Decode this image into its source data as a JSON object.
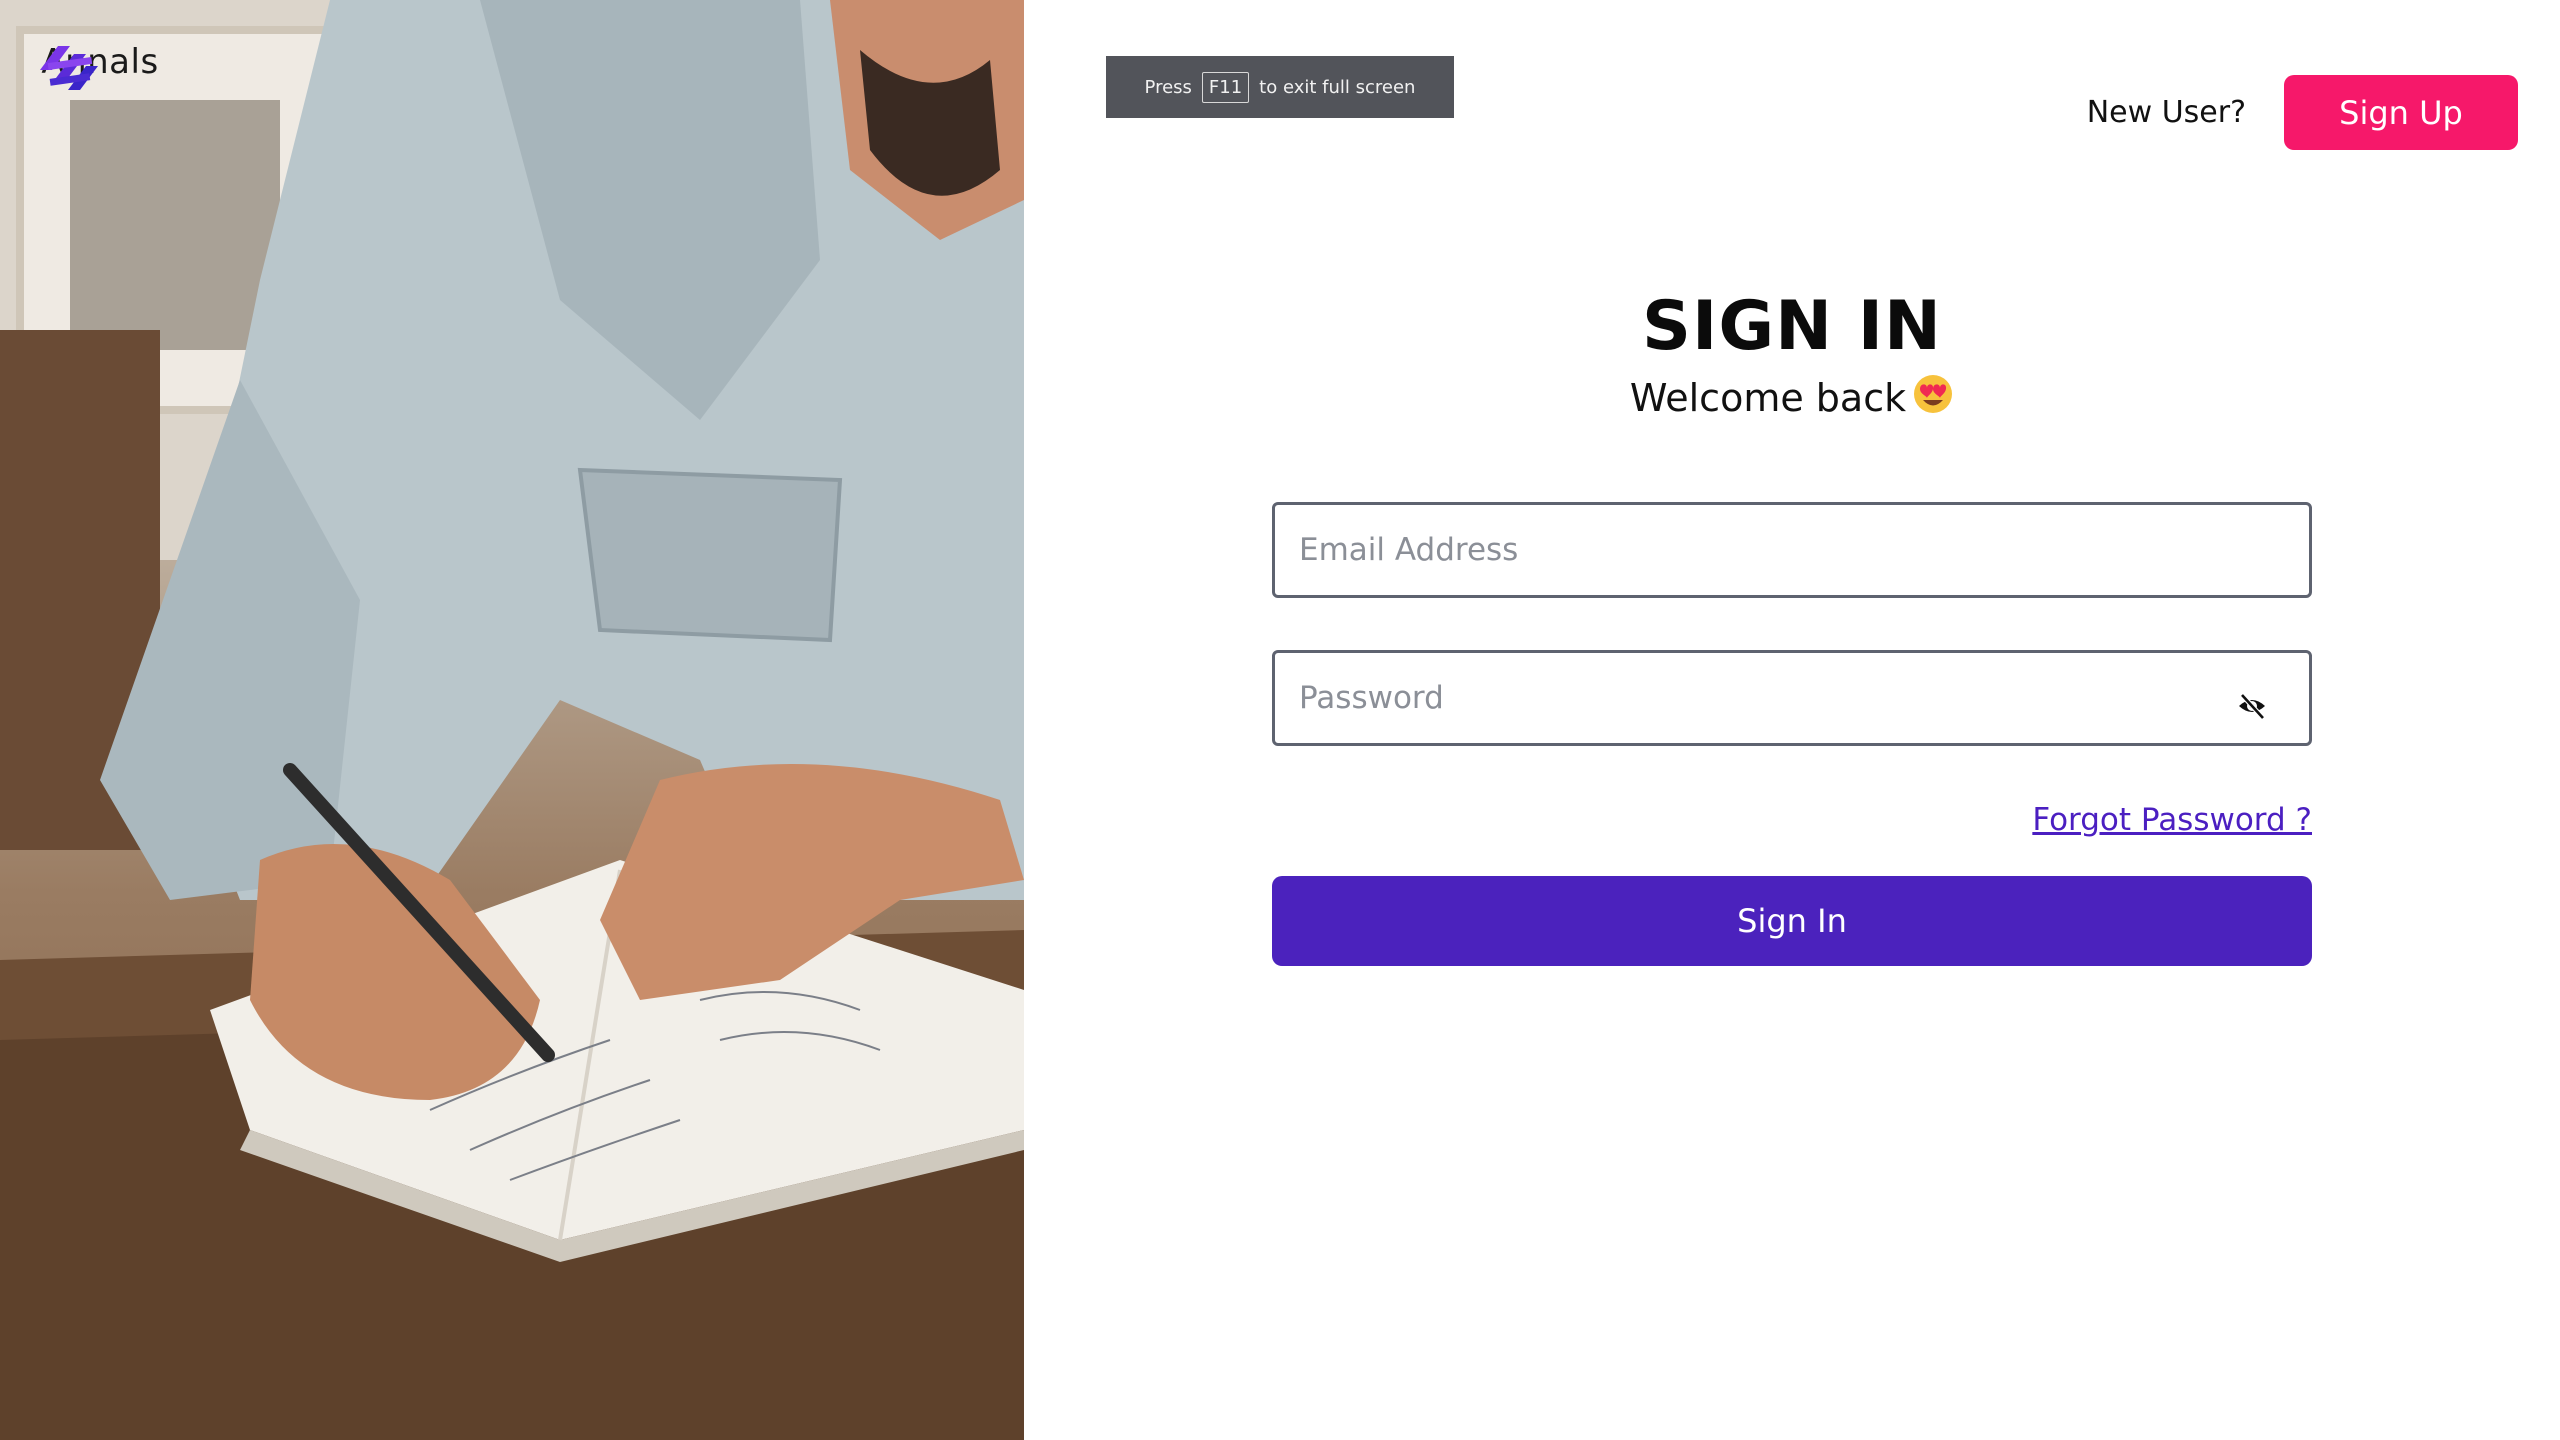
{
  "brand": {
    "name": "Annals",
    "logo_icon": "annals-logo-icon",
    "accent_color": "#6a2fe0"
  },
  "fullscreen_notice": {
    "prefix": "Press",
    "key": "F11",
    "suffix": "to exit full screen"
  },
  "header": {
    "new_user_label": "New User?",
    "signup_label": "Sign Up",
    "signup_color": "#f6186a"
  },
  "form": {
    "title": "SIGN IN",
    "subtitle": "Welcome back",
    "subtitle_emoji_icon": "heart-eyes-emoji-icon",
    "email": {
      "placeholder": "Email Address",
      "value": ""
    },
    "password": {
      "placeholder": "Password",
      "value": "",
      "toggle_icon": "eye-off-icon"
    },
    "forgot_label": "Forgot Password ?",
    "submit_label": "Sign In",
    "submit_color": "#4b22bd"
  }
}
